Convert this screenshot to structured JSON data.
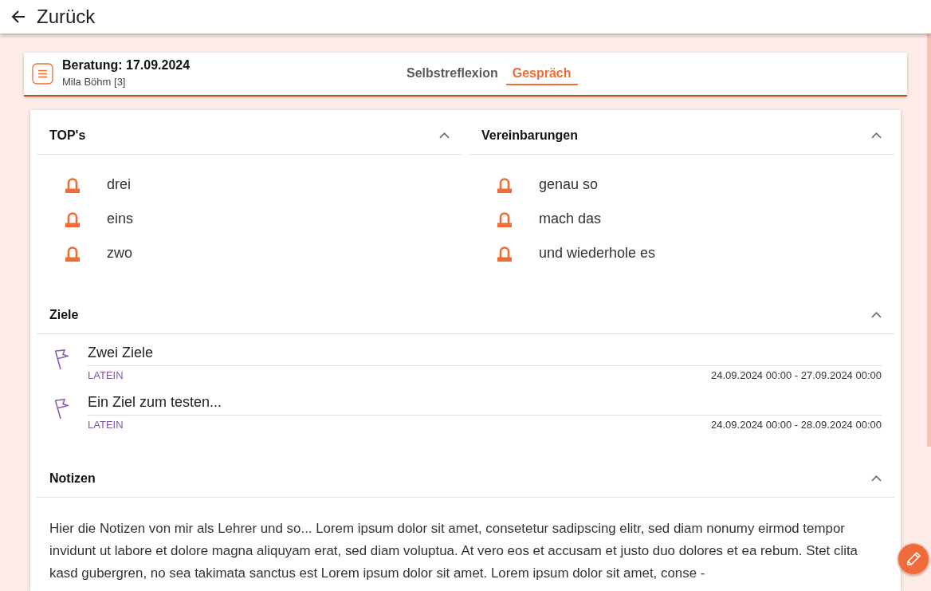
{
  "top_bar": {
    "back_label": "Zurück"
  },
  "header": {
    "title": "Beratung: 17.09.2024",
    "subtitle": "Mila Böhm [3]",
    "tabs": [
      {
        "label": "Selbstreflexion",
        "selected": false
      },
      {
        "label": "Gespräch",
        "selected": true
      }
    ]
  },
  "sections": [
    {
      "kind": "list",
      "title": "TOP's",
      "expanded": true,
      "items": [
        "drei",
        "eins",
        "zwo"
      ]
    },
    {
      "kind": "list",
      "title": "Vereinbarungen",
      "expanded": true,
      "items": [
        "genau so",
        "mach das",
        "und wiederhole es"
      ]
    },
    {
      "kind": "goals",
      "title": "Ziele",
      "expanded": true,
      "goals": [
        {
          "title": "Zwei Ziele",
          "subject": "LATEIN",
          "period": "24.09.2024 00:00 - 27.09.2024 00:00"
        },
        {
          "title": "Ein Ziel zum testen...",
          "subject": "LATEIN",
          "period": "24.09.2024 00:00 - 28.09.2024 00:00"
        }
      ]
    },
    {
      "kind": "text",
      "title": "Notizen",
      "expanded": true,
      "text": "Hier die Notizen von mir als Lehrer und so... Lorem ipsum dolor sit amet, consetetur sadipscing elitr, sed diam nonumy eirmod tempor invidunt ut labore et dolore magna aliquyam erat, sed diam voluptua. At vero eos et accusam et justo duo dolores et ea rebum. Stet clita kasd gubergren, no sea takimata sanctus est Lorem ipsum dolor sit amet. Lorem ipsum dolor sit amet, conse -"
    }
  ]
}
